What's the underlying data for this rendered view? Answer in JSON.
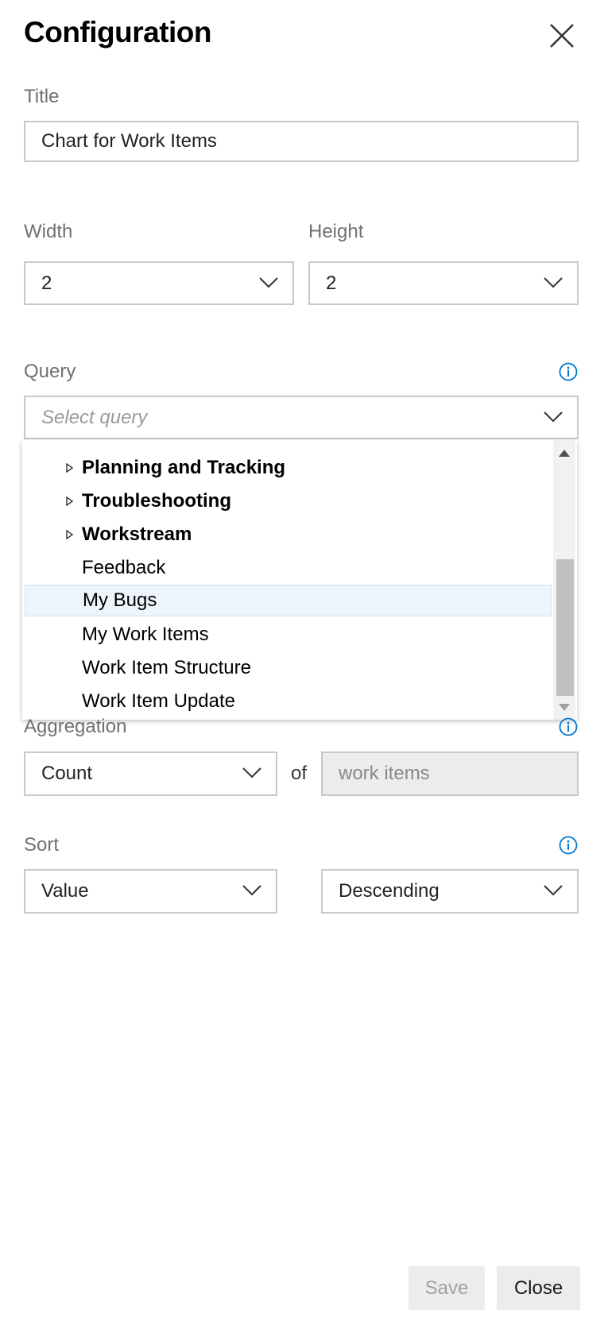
{
  "dialog": {
    "title": "Configuration"
  },
  "title_field": {
    "label": "Title",
    "value": "Chart for Work Items"
  },
  "width_field": {
    "label": "Width",
    "value": "2"
  },
  "height_field": {
    "label": "Height",
    "value": "2"
  },
  "query_field": {
    "label": "Query",
    "placeholder": "Select query",
    "options": [
      {
        "label": "Planning and Tracking",
        "folder": true
      },
      {
        "label": "Troubleshooting",
        "folder": true
      },
      {
        "label": "Workstream",
        "folder": true
      },
      {
        "label": "Feedback",
        "folder": false
      },
      {
        "label": "My Bugs",
        "folder": false,
        "highlighted": true
      },
      {
        "label": "My Work Items",
        "folder": false
      },
      {
        "label": "Work Item Structure",
        "folder": false
      },
      {
        "label": "Work Item Update",
        "folder": false
      }
    ]
  },
  "aggregation": {
    "label": "Aggregation",
    "type_value": "Count",
    "of_label": "of",
    "target_value": "work items"
  },
  "sort": {
    "label": "Sort",
    "by_value": "Value",
    "order_value": "Descending"
  },
  "footer": {
    "save_label": "Save",
    "close_label": "Close"
  },
  "colors": {
    "accent": "#0078d4",
    "border": "#c8c8c8",
    "highlight": "#eef4fb"
  }
}
